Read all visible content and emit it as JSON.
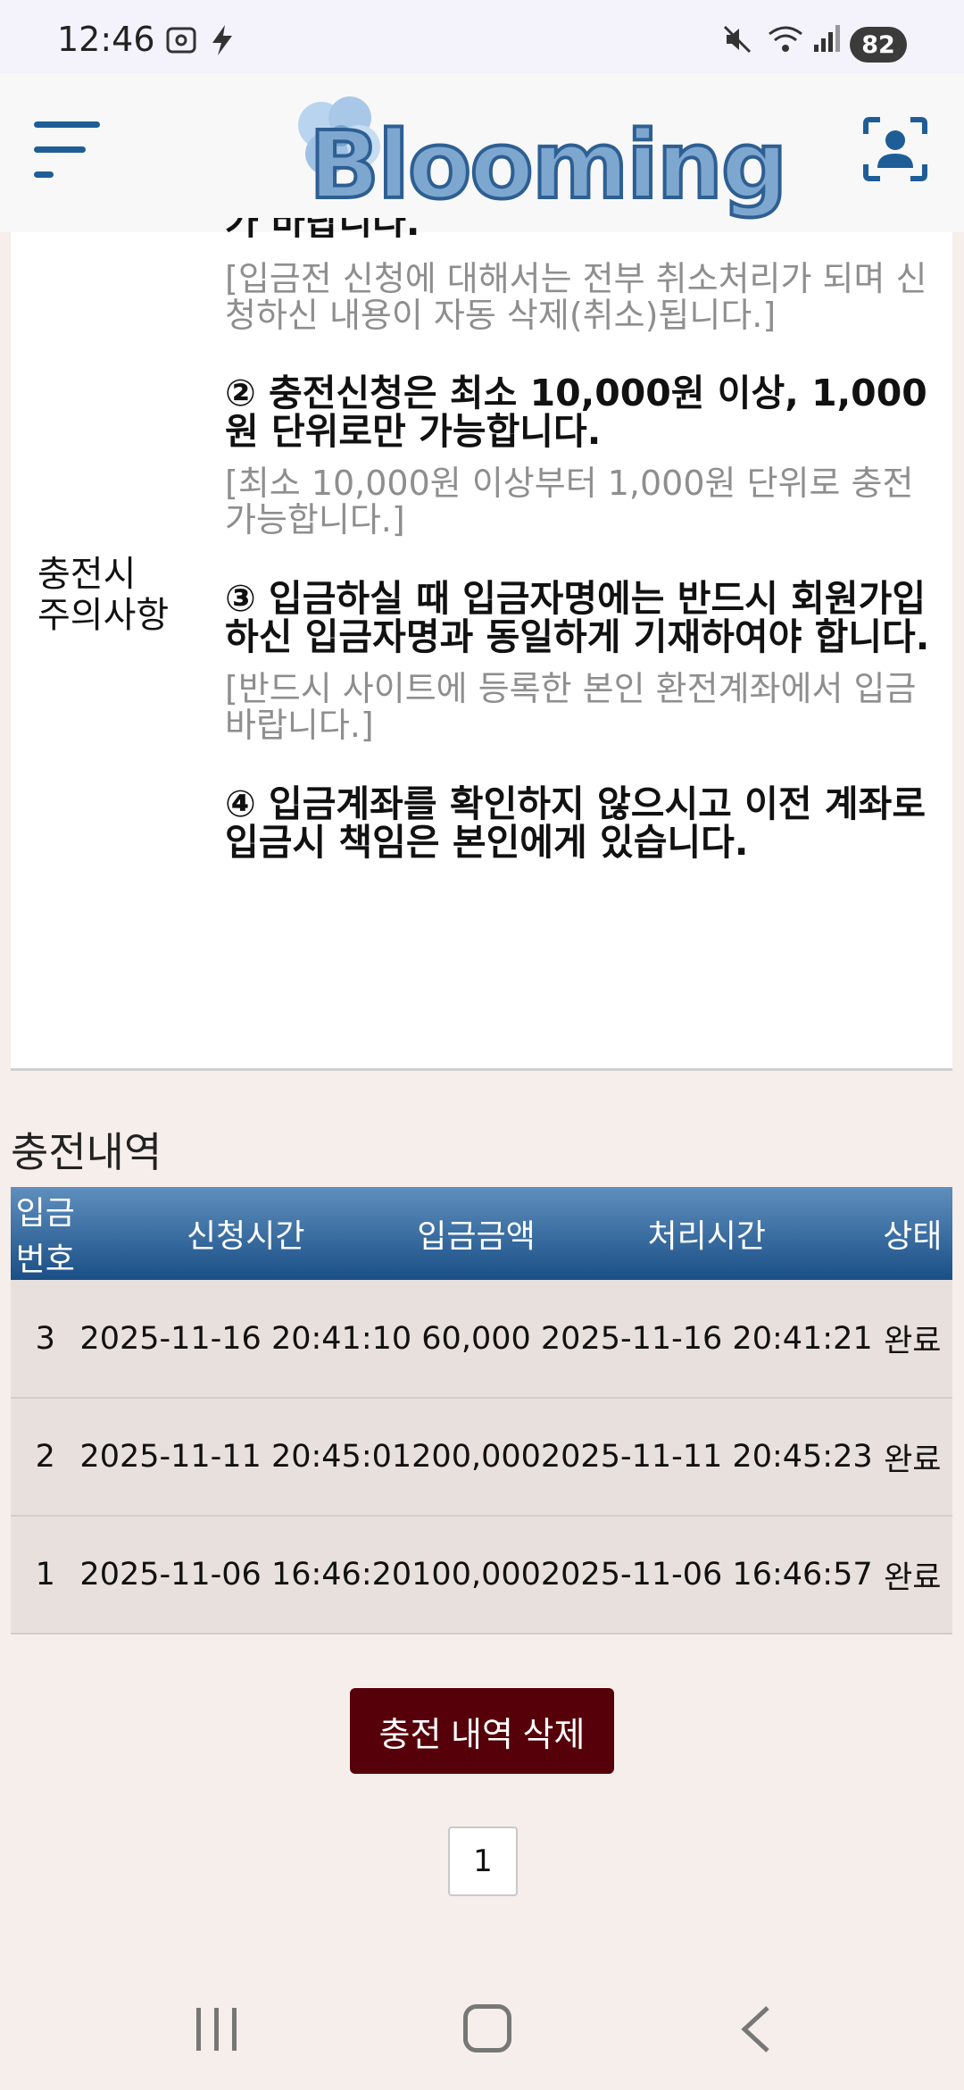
{
  "status_bar": {
    "time": "12:46",
    "battery": "82",
    "icons": [
      "screenshot-icon",
      "charging-icon",
      "mute-icon",
      "wifi-icon",
      "signal-icon"
    ]
  },
  "header": {
    "logo_text": "Blooming",
    "menu_icon": "hamburger-menu-icon",
    "profile_icon": "user-profile-icon"
  },
  "notice": {
    "label_line1": "충전시",
    "label_line2": "주의사항",
    "cut_line": "가 바랍니다.",
    "item1_sub": "[입금전 신청에 대해서는 전부 취소처리가 되며 신청하신 내용이 자동 삭제(취소)됩니다.]",
    "item2": "② 충전신청은 최소 10,000원 이상, 1,000원 단위로만 가능합니다.",
    "item2_sub": "[최소 10,000원 이상부터 1,000원 단위로 충전 가능합니다.]",
    "item3": "③ 입금하실 때 입금자명에는 반드시 회원가입하신 입금자명과 동일하게 기재하여야 합니다.",
    "item3_sub": "[반드시 사이트에 등록한 본인 환전계좌에서 입금 바랍니다.]",
    "item4": "④ 입금계좌를 확인하지 않으시고 이전 계좌로 입금시 책임은 본인에게 있습니다."
  },
  "history": {
    "title": "충전내역",
    "columns": [
      "입금번호",
      "신청시간",
      "입금금액",
      "처리시간",
      "상태"
    ],
    "rows": [
      [
        "3",
        "2025-11-16 20:41:10",
        "60,000",
        "2025-11-16 20:41:21",
        "완료"
      ],
      [
        "2",
        "2025-11-11 20:45:01",
        "200,000",
        "2025-11-11 20:45:23",
        "완료"
      ],
      [
        "1",
        "2025-11-06 16:46:20",
        "100,000",
        "2025-11-06 16:46:57",
        "완료"
      ]
    ],
    "delete_label": "충전 내역 삭제",
    "page": "1"
  },
  "colors": {
    "header_blue": "#1a4f86",
    "delete_button": "#56000a",
    "page_background": "#f6eeea"
  }
}
